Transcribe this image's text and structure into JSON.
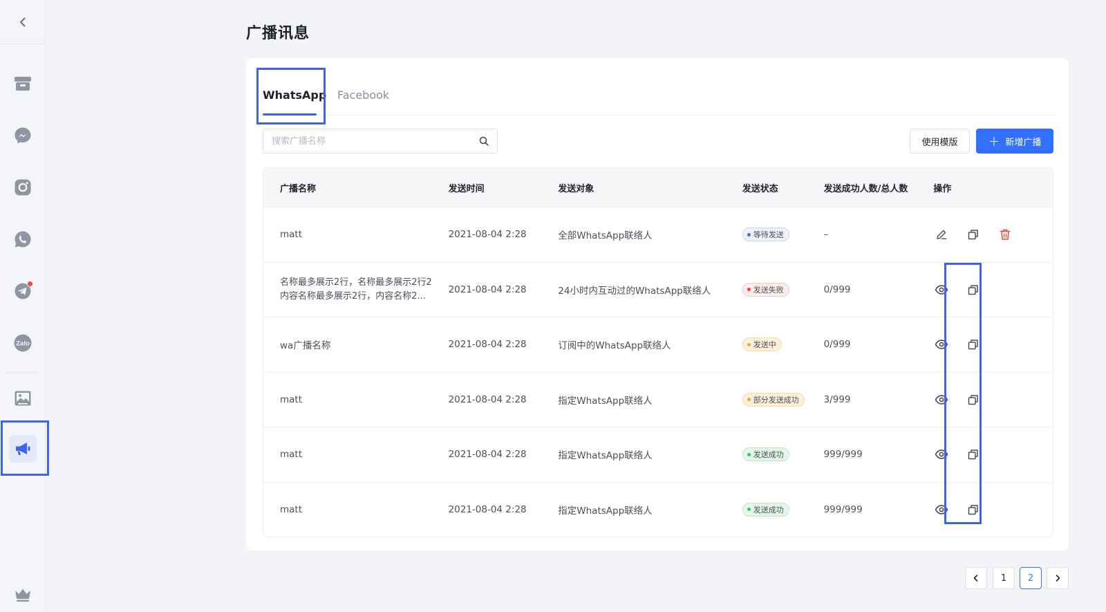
{
  "page": {
    "title": "广播讯息"
  },
  "sidebar": {
    "items": [
      {
        "name": "store-icon"
      },
      {
        "name": "messenger-icon"
      },
      {
        "name": "instagram-icon"
      },
      {
        "name": "whatsapp-icon"
      },
      {
        "name": "telegram-icon",
        "badge": true
      },
      {
        "name": "zalo-icon",
        "label": "Zalo"
      },
      {
        "name": "gallery-icon"
      },
      {
        "name": "broadcast-icon",
        "active": true
      },
      {
        "name": "crown-icon"
      }
    ]
  },
  "tabs": [
    {
      "label": "WhatsApp",
      "active": true
    },
    {
      "label": "Facebook",
      "active": false
    }
  ],
  "search": {
    "placeholder": "搜索广播名称"
  },
  "toolbar": {
    "template_label": "使用模版",
    "new_label": "新增广播"
  },
  "table": {
    "columns": [
      "广播名称",
      "发送时间",
      "发送对象",
      "发送状态",
      "发送成功人数/总人数",
      "操作"
    ],
    "rows": [
      {
        "name": "matt",
        "time": "2021-08-04 2:28",
        "target": "全部WhatsApp联络人",
        "status": "等待发送",
        "status_type": "waiting",
        "count": "–",
        "actions": [
          "edit",
          "copy",
          "delete"
        ]
      },
      {
        "name": "名称最多展示2行，名称最多展示2行2内容名称最多展示2行，内容名称2...",
        "name_line1": "名称最多展示2行，名称最多展示2行2",
        "name_line2": "内容名称最多展示2行，内容名称2...",
        "time": "2021-08-04 2:28",
        "target": "24小时内互动过的WhatsApp联络人",
        "status": "发送失败",
        "status_type": "failed",
        "count": "0/999",
        "actions": [
          "view",
          "copy"
        ]
      },
      {
        "name": "wa广播名称",
        "time": "2021-08-04 2:28",
        "target": "订阅中的WhatsApp联络人",
        "status": "发送中",
        "status_type": "sending",
        "count": "0/999",
        "actions": [
          "view",
          "copy"
        ]
      },
      {
        "name": "matt",
        "time": "2021-08-04 2:28",
        "target": "指定WhatsApp联络人",
        "status": "部分发送成功",
        "status_type": "partial",
        "count": "3/999",
        "actions": [
          "view",
          "copy"
        ]
      },
      {
        "name": "matt",
        "time": "2021-08-04 2:28",
        "target": "指定WhatsApp联络人",
        "status": "发送成功",
        "status_type": "success",
        "count": "999/999",
        "actions": [
          "view",
          "copy"
        ]
      },
      {
        "name": "matt",
        "time": "2021-08-04 2:28",
        "target": "指定WhatsApp联络人",
        "status": "发送成功",
        "status_type": "success",
        "count": "999/999",
        "actions": [
          "view",
          "copy"
        ]
      }
    ]
  },
  "status_colors": {
    "waiting": {
      "bg": "#eef2fc",
      "border": "#c9d5f5",
      "dot": "#3370ff",
      "text": "#4a4f59"
    },
    "failed": {
      "bg": "#fdecec",
      "border": "#f7c9c9",
      "dot": "#f04438",
      "text": "#4a4f59"
    },
    "sending": {
      "bg": "#fdf1dc",
      "border": "#f6dba8",
      "dot": "#f5a623",
      "text": "#4a4f59"
    },
    "partial": {
      "bg": "#fdf1dc",
      "border": "#f6dba8",
      "dot": "#f5a623",
      "text": "#4a4f59"
    },
    "success": {
      "bg": "#e6f6ea",
      "border": "#bfe6c8",
      "dot": "#34c759",
      "text": "#4a4f59"
    }
  },
  "pagination": {
    "pages": [
      "1",
      "2"
    ],
    "current": "2"
  },
  "colors": {
    "accent": "#3370ff",
    "highlight": "#3f62ef",
    "danger": "#f04438"
  }
}
